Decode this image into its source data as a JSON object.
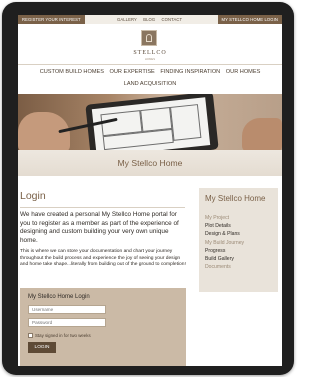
{
  "topbar": {
    "register": "REGISTER YOUR INTEREST",
    "links": [
      "GALLERY",
      "BLOG",
      "CONTACT"
    ],
    "my_login": "MY STELLCO HOME LOGIN"
  },
  "logo": {
    "brand": "STELLCO",
    "sub": "HOMES"
  },
  "nav": {
    "row1": [
      "CUSTOM BUILD HOMES",
      "OUR EXPERTISE",
      "FINDING INSPIRATION",
      "OUR HOMES"
    ],
    "row2": "LAND ACQUISITION"
  },
  "banner": {
    "title": "My Stellco Home"
  },
  "main": {
    "title": "Login",
    "intro": "We have created a personal My Stellco Home portal for you to register as a member as part of the experience of designing and custom building your very own unique home.",
    "desc": "This is where we can store your documentation and chart your journey throughout the build process and experience the joy of seeing your design and home take shape...literally from building out of the ground to completion!",
    "login_box": {
      "title": "My Stellco Home Login",
      "username_placeholder": "Username",
      "password_placeholder": "Password",
      "remember": "Stay signed in for two weeks",
      "button": "LOGIN"
    }
  },
  "sidebar": {
    "title": "My Stellco Home",
    "items": [
      {
        "label": "My Project",
        "style": "muted"
      },
      {
        "label": "Plot Details",
        "style": "dark"
      },
      {
        "label": "Design & Plans",
        "style": "dark"
      },
      {
        "label": "My Build Journey",
        "style": "muted"
      },
      {
        "label": "Progress",
        "style": "dark"
      },
      {
        "label": "Build Gallery",
        "style": "dark"
      },
      {
        "label": "Documents",
        "style": "muted"
      }
    ]
  },
  "colors": {
    "brand_brown": "#7a6148",
    "sidebar_bg": "#e9e3da",
    "login_box_bg": "#cbbaa6"
  }
}
